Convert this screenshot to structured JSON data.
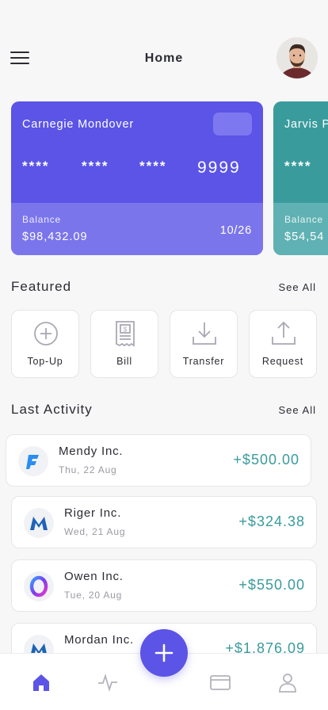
{
  "header": {
    "title": "Home",
    "menu_icon": "hamburger-menu-icon",
    "avatar": "user-avatar"
  },
  "cards": [
    {
      "holder": "Carnegie Mondover",
      "mask": [
        "****",
        "****",
        "****"
      ],
      "last4": "9999",
      "balance_label": "Balance",
      "balance": "$98,432.09",
      "expiry": "10/26",
      "color": "#5b54e6",
      "accent": "#7b75ec"
    },
    {
      "holder": "Jarvis P",
      "mask": [
        "****"
      ],
      "last4": "",
      "balance_label": "Balance",
      "balance": "$54,54",
      "expiry": "",
      "color": "#3a9b9d",
      "accent": "#5fb1b3"
    }
  ],
  "featured": {
    "title": "Featured",
    "see_all": "See All",
    "items": [
      {
        "label": "Top-Up",
        "icon": "plus-circle-icon"
      },
      {
        "label": "Bill",
        "icon": "receipt-icon"
      },
      {
        "label": "Transfer",
        "icon": "download-icon"
      },
      {
        "label": "Request",
        "icon": "upload-icon"
      }
    ]
  },
  "activity": {
    "title": "Last Activity",
    "see_all": "See All",
    "items": [
      {
        "name": "Mendy Inc.",
        "date": "Thu, 22 Aug",
        "amount": "+$500.00",
        "logo": "mendy-logo"
      },
      {
        "name": "Riger Inc.",
        "date": "Wed, 21 Aug",
        "amount": "+$324.38",
        "logo": "riger-logo"
      },
      {
        "name": "Owen Inc.",
        "date": "Tue, 20 Aug",
        "amount": "+$550.00",
        "logo": "owen-logo"
      },
      {
        "name": "Mordan Inc.",
        "date": "",
        "amount": "+$1,876.09",
        "logo": "mordan-logo"
      }
    ]
  },
  "tabbar": {
    "items": [
      "home-icon",
      "activity-icon",
      "card-icon",
      "profile-icon"
    ],
    "active": "home-icon",
    "fab_icon": "plus-icon"
  },
  "colors": {
    "primary": "#5b54e6",
    "teal": "#3a9b9d",
    "text": "#2b2b33",
    "muted": "#9a9aa2"
  }
}
